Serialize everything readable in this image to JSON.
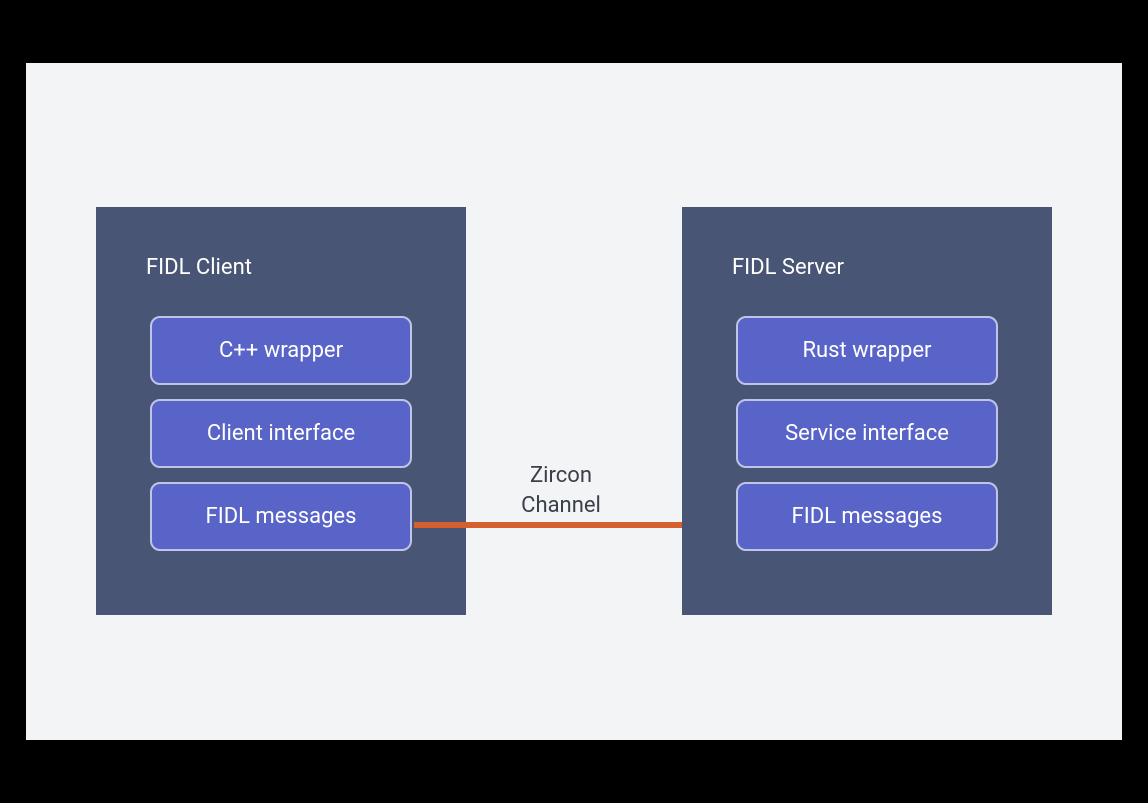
{
  "client": {
    "title": "FIDL Client",
    "layers": [
      "C++ wrapper",
      "Client interface",
      "FIDL messages"
    ]
  },
  "server": {
    "title": "FIDL Server",
    "layers": [
      "Rust wrapper",
      "Service interface",
      "FIDL messages"
    ]
  },
  "channel": {
    "label_line1": "Zircon",
    "label_line2": "Channel"
  },
  "colors": {
    "canvas_bg": "#f2f4f6",
    "box_bg": "#495575",
    "chip_bg": "#5864c7",
    "chip_border": "#bfc4e8",
    "line": "#d55f2e"
  }
}
